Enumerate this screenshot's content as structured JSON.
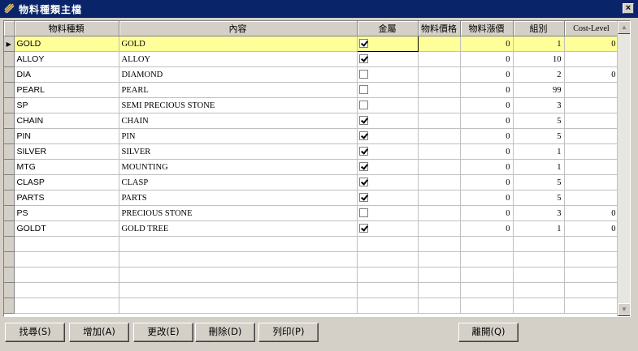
{
  "window": {
    "title": "物料種類主檔",
    "close_glyph": "×"
  },
  "columns": [
    "物料種類",
    "內容",
    "金屬",
    "物料價格",
    "物料漲價",
    "組別",
    "Cost-Level"
  ],
  "rows": [
    {
      "code": "GOLD",
      "content": "GOLD",
      "metal": true,
      "price": "",
      "increase": "0",
      "group": "1",
      "level": "0",
      "selected": true
    },
    {
      "code": "ALLOY",
      "content": "ALLOY",
      "metal": true,
      "price": "",
      "increase": "0",
      "group": "10",
      "level": ""
    },
    {
      "code": "DIA",
      "content": "DIAMOND",
      "metal": false,
      "price": "",
      "increase": "0",
      "group": "2",
      "level": "0"
    },
    {
      "code": "PEARL",
      "content": "PEARL",
      "metal": false,
      "price": "",
      "increase": "0",
      "group": "99",
      "level": ""
    },
    {
      "code": "SP",
      "content": "SEMI PRECIOUS STONE",
      "metal": false,
      "price": "",
      "increase": "0",
      "group": "3",
      "level": ""
    },
    {
      "code": "CHAIN",
      "content": "CHAIN",
      "metal": true,
      "price": "",
      "increase": "0",
      "group": "5",
      "level": ""
    },
    {
      "code": "PIN",
      "content": "PIN",
      "metal": true,
      "price": "",
      "increase": "0",
      "group": "5",
      "level": ""
    },
    {
      "code": "SILVER",
      "content": "SILVER",
      "metal": true,
      "price": "",
      "increase": "0",
      "group": "1",
      "level": ""
    },
    {
      "code": "MTG",
      "content": "MOUNTING",
      "metal": true,
      "price": "",
      "increase": "0",
      "group": "1",
      "level": ""
    },
    {
      "code": "CLASP",
      "content": "CLASP",
      "metal": true,
      "price": "",
      "increase": "0",
      "group": "5",
      "level": ""
    },
    {
      "code": "PARTS",
      "content": "PARTS",
      "metal": true,
      "price": "",
      "increase": "0",
      "group": "5",
      "level": ""
    },
    {
      "code": "PS",
      "content": "PRECIOUS STONE",
      "metal": false,
      "price": "",
      "increase": "0",
      "group": "3",
      "level": "0"
    },
    {
      "code": "GOLDT",
      "content": "GOLD TREE",
      "metal": true,
      "price": "",
      "increase": "0",
      "group": "1",
      "level": "0"
    }
  ],
  "empty_rows": 5,
  "buttons": {
    "find": "找尋(S)",
    "add": "增加(A)",
    "edit": "更改(E)",
    "delete": "刪除(D)",
    "print": "列印(P)",
    "exit": "離開(Q)"
  },
  "colors": {
    "titlebar": "#0a246a",
    "selected_row": "#ffff99",
    "face": "#d4d0c8"
  },
  "icons": {
    "app": "app-icon",
    "close": "close-icon",
    "row_pointer": "row-pointer-icon",
    "scroll_up": "scroll-up-icon",
    "scroll_down": "scroll-down-icon"
  }
}
